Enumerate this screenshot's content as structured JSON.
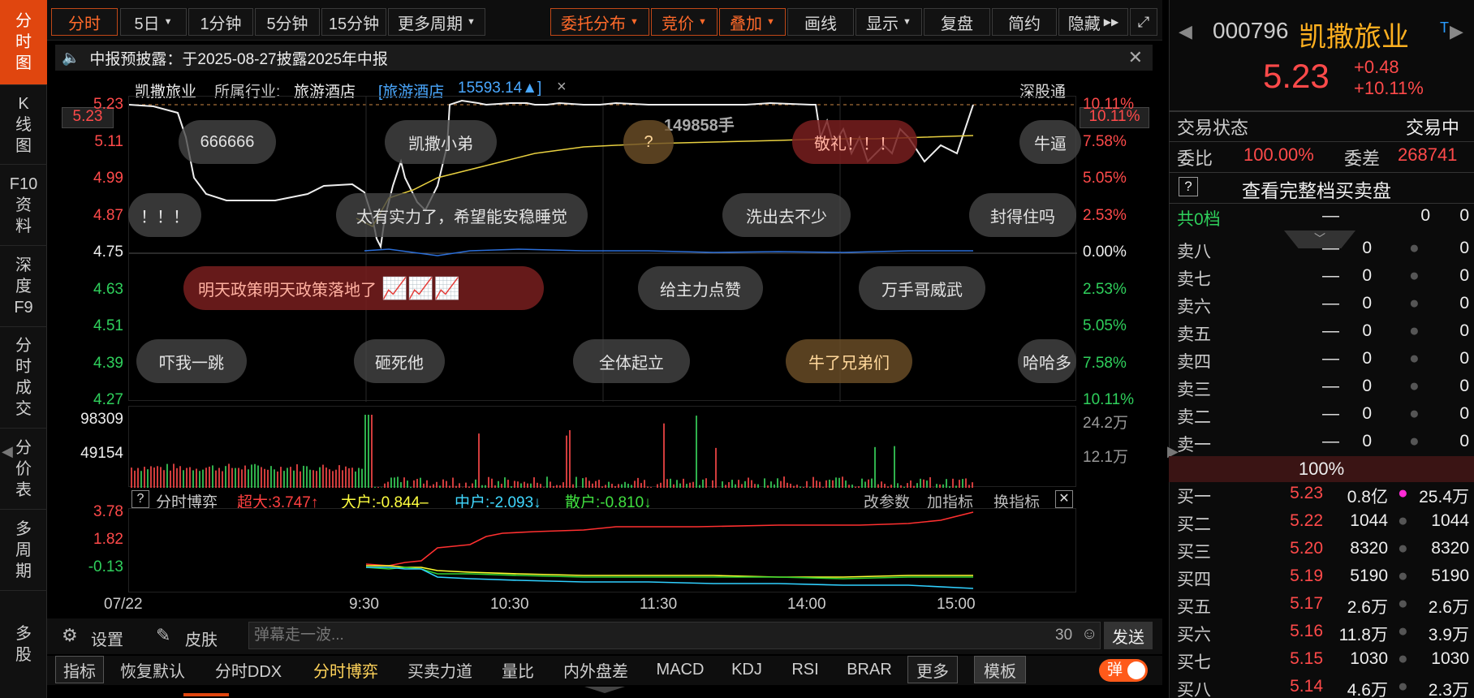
{
  "nav": {
    "items": [
      [
        "分",
        "时",
        "图"
      ],
      [
        "K",
        "线",
        "图"
      ],
      [
        "F10",
        "资",
        "料"
      ],
      [
        "深",
        "度",
        "F9"
      ],
      [
        "分",
        "时",
        "成",
        "交"
      ],
      [
        "分",
        "价",
        "表"
      ],
      [
        "多",
        "周",
        "期"
      ],
      [
        "多",
        "股"
      ]
    ]
  },
  "toolbar": {
    "left": [
      "分时",
      "5日",
      "1分钟",
      "5分钟",
      "15分钟",
      "更多周期"
    ],
    "right": [
      "委托分布",
      "竞价",
      "叠加",
      "画线",
      "显示",
      "复盘",
      "简约",
      "隐藏"
    ]
  },
  "notice": {
    "text": "中报预披露：于2025-08-27披露2025年中报"
  },
  "header": {
    "name": "凯撒旅业",
    "industry_label": "所属行业:",
    "industry": "旅游酒店",
    "sector": "[旅游酒店",
    "sector_val": "15593.14▲]",
    "exchange": "深股通"
  },
  "price_axis": {
    "left": [
      "5.23",
      "5.11",
      "4.99",
      "4.87",
      "4.75",
      "4.63",
      "4.51",
      "4.39",
      "4.27"
    ],
    "right": [
      "10.11%",
      "7.58%",
      "5.05%",
      "2.53%",
      "0.00%",
      "2.53%",
      "5.05%",
      "7.58%",
      "10.11%"
    ],
    "current": "5.23",
    "current_pct": "10.11%"
  },
  "vol_label": "149858手",
  "bubbles": [
    "666666",
    "凯撒小弟",
    "?",
    "敬礼！！！",
    "牛逼",
    "！！！",
    "太有实力了，希望能安稳睡觉",
    "洗出去不少",
    "封得住吗",
    "明天政策明天政策落地了",
    "给主力点赞",
    "万手哥威武",
    "吓我一跳",
    "砸死他",
    "全体起立",
    "牛了兄弟们",
    "哈哈多"
  ],
  "volume_axis": {
    "left": [
      "98309",
      "49154"
    ],
    "right": [
      "24.2万",
      "12.1万"
    ]
  },
  "indicator": {
    "name": "分时博弈",
    "super": "超大:3.747↑",
    "big": "大户:-0.844–",
    "mid": "中户:-2.093↓",
    "small": "散户:-0.810↓",
    "buttons": [
      "改参数",
      "加指标",
      "换指标"
    ],
    "axis": [
      "3.78",
      "1.82",
      "-0.13"
    ]
  },
  "time_axis": [
    "07/22",
    "9:30",
    "10:30",
    "11:30",
    "14:00",
    "15:00"
  ],
  "bottom": {
    "settings": "设置",
    "skin": "皮肤",
    "input_placeholder": "弹幕走一波...",
    "count": "30",
    "send": "发送"
  },
  "tabs": [
    "指标",
    "恢复默认",
    "分时DDX",
    "分时博弈",
    "买卖力道",
    "量比",
    "内外盘差",
    "MACD",
    "KDJ",
    "RSI",
    "BRAR",
    "更多",
    "模板",
    "弹"
  ],
  "quote": {
    "code": "000796",
    "name": "凯撒旅业",
    "price": "5.23",
    "change": "+0.48",
    "pct": "+10.11%",
    "status_label": "交易状态",
    "status": "交易中",
    "ratio_label": "委比",
    "ratio": "100.00%",
    "diff_label": "委差",
    "diff": "268741",
    "full_book": "查看完整档买卖盘",
    "total_label": "共0档",
    "dash": "—",
    "zero": "0",
    "pct_bar": "100%"
  },
  "asks": [
    [
      "卖八",
      "—",
      "0",
      "0"
    ],
    [
      "卖七",
      "—",
      "0",
      "0"
    ],
    [
      "卖六",
      "—",
      "0",
      "0"
    ],
    [
      "卖五",
      "—",
      "0",
      "0"
    ],
    [
      "卖四",
      "—",
      "0",
      "0"
    ],
    [
      "卖三",
      "—",
      "0",
      "0"
    ],
    [
      "卖二",
      "—",
      "0",
      "0"
    ],
    [
      "卖一",
      "—",
      "0",
      "0"
    ]
  ],
  "bids": [
    [
      "买一",
      "5.23",
      "0.8亿",
      "25.4万"
    ],
    [
      "买二",
      "5.22",
      "1044",
      "1044"
    ],
    [
      "买三",
      "5.20",
      "8320",
      "8320"
    ],
    [
      "买四",
      "5.19",
      "5190",
      "5190"
    ],
    [
      "买五",
      "5.17",
      "2.6万",
      "2.6万"
    ],
    [
      "买六",
      "5.16",
      "11.8万",
      "3.9万"
    ],
    [
      "买七",
      "5.15",
      "1030",
      "1030"
    ],
    [
      "买八",
      "5.14",
      "4.6万",
      "2.3万"
    ]
  ],
  "colors": {
    "up": "#ff4a4a",
    "down": "#2fd05c",
    "accent": "#e0460f",
    "gold": "#ffb020"
  }
}
